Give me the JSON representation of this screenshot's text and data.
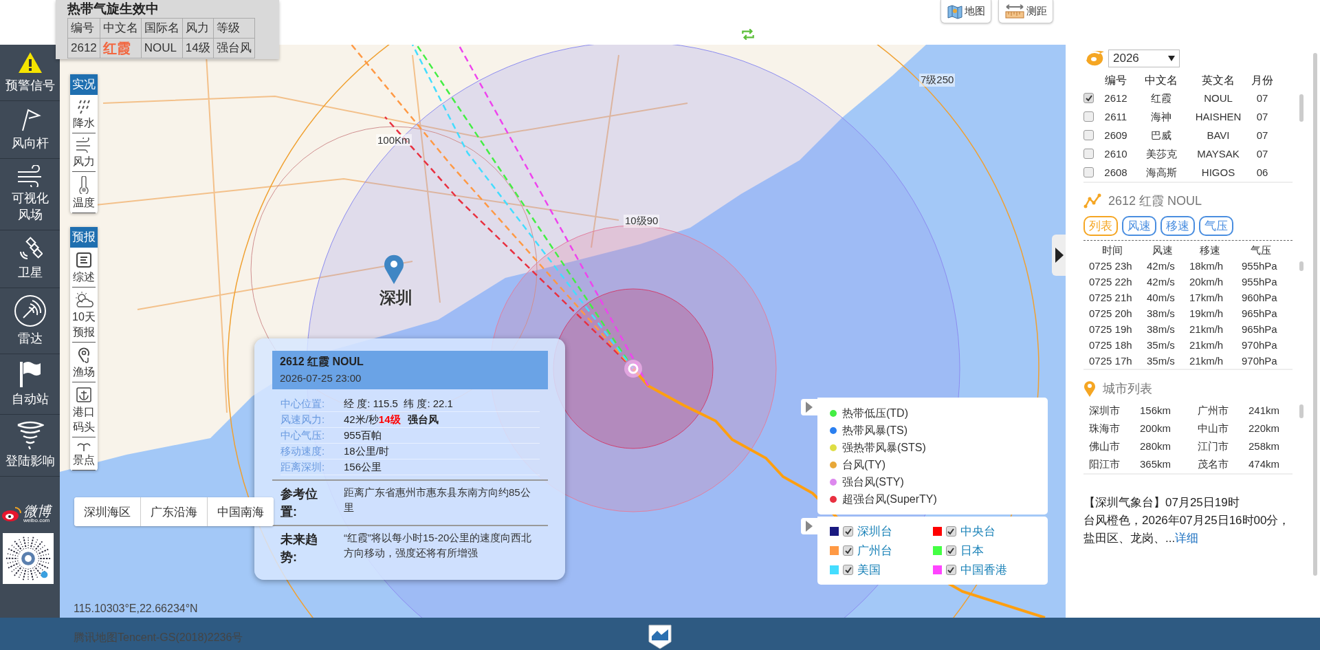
{
  "info_box": {
    "title": "热带气旋生效中",
    "columns": [
      "编号",
      "中文名",
      "国际名",
      "风力",
      "等级"
    ],
    "row": [
      "2612",
      "红霞",
      "NOUL",
      "14级",
      "强台风"
    ]
  },
  "toolbar": [
    {
      "kind": "map",
      "label": "地图"
    },
    {
      "kind": "ruler",
      "label": "测距"
    }
  ],
  "sidebar": [
    {
      "kind": "warning",
      "lines": [
        "预警信号"
      ]
    },
    {
      "kind": "vane",
      "lines": [
        "风向杆"
      ]
    },
    {
      "kind": "wind",
      "lines": [
        "可视化",
        "风场"
      ]
    },
    {
      "kind": "satellite",
      "lines": [
        "卫星"
      ]
    },
    {
      "kind": "radar",
      "lines": [
        "雷达"
      ]
    },
    {
      "kind": "flag",
      "lines": [
        "自动站"
      ]
    },
    {
      "kind": "tornado",
      "lines": [
        "登陆影响"
      ]
    }
  ],
  "weibo": {
    "name": "微博",
    "site": "weibo.com"
  },
  "layers": [
    {
      "title": "实况",
      "items": [
        {
          "kind": "rain",
          "lines": [
            "降水"
          ]
        },
        {
          "kind": "wind",
          "lines": [
            "风力"
          ]
        },
        {
          "kind": "temp",
          "lines": [
            "温度"
          ]
        }
      ]
    },
    {
      "title": "预报",
      "items": [
        {
          "kind": "summary",
          "lines": [
            "综述"
          ]
        },
        {
          "kind": "suncloud",
          "lines": [
            "10天",
            "预报"
          ]
        },
        {
          "kind": "fishing",
          "lines": [
            "渔场"
          ]
        },
        {
          "kind": "anchor",
          "lines": [
            "港口",
            "码头"
          ]
        },
        {
          "kind": "scenic",
          "lines": [
            "景点"
          ]
        }
      ]
    }
  ],
  "region_tabs": [
    "深圳海区",
    "广东沿海",
    "中国南海"
  ],
  "map": {
    "pin_label": "深圳",
    "circle_labels": [
      "100Km",
      "10级90",
      "7级250"
    ]
  },
  "popup": {
    "title": "2612 红霞 NOUL",
    "time": "2026-07-25 23:00",
    "details": [
      {
        "kind": "text",
        "label": "中心位置:",
        "value": "经 度: 115.5  纬 度: 22.1"
      },
      {
        "kind": "wind",
        "label": "风速风力:",
        "speed": "42米/秒",
        "force": "14级",
        "category": "强台风"
      },
      {
        "kind": "text",
        "label": "中心气压:",
        "value": "955百帕"
      },
      {
        "kind": "text",
        "label": "移动速度:",
        "value": "18公里/时"
      },
      {
        "kind": "text",
        "label": "距离深圳:",
        "value": "156公里"
      }
    ],
    "notes": [
      {
        "label": "参考位置:",
        "text": "距离广东省惠州市惠东县东南方向约85公里"
      },
      {
        "label": "未来趋势:",
        "text": "“红霞”将以每小时15-20公里的速度向西北方向移动，强度还将有所增强"
      }
    ]
  },
  "levels": [
    {
      "label": "热带低压(TD)",
      "color": "#44ee44"
    },
    {
      "label": "热带风暴(TS)",
      "color": "#2a7ff0"
    },
    {
      "label": "强热带风暴(STS)",
      "color": "#dede44"
    },
    {
      "label": "台风(TY)",
      "color": "#e8a838"
    },
    {
      "label": "强台风(STY)",
      "color": "#dd88ee"
    },
    {
      "label": "超强台风(SuperTY)",
      "color": "#e83040"
    }
  ],
  "agencies": [
    {
      "label": "深圳台",
      "color": "#1a1a80",
      "checked": true
    },
    {
      "label": "中央台",
      "color": "#ff0000",
      "checked": true
    },
    {
      "label": "广州台",
      "color": "#ff9944",
      "checked": true
    },
    {
      "label": "日本",
      "color": "#44ff44",
      "checked": true
    },
    {
      "label": "美国",
      "color": "#44ddff",
      "checked": true
    },
    {
      "label": "中国香港",
      "color": "#ff44ff",
      "checked": true
    }
  ],
  "coords": "115.10303°E,22.66234°N",
  "copyright": "腾讯地图Tencent-GS(2018)2236号",
  "panel": {
    "year": "2026",
    "typhoon_columns": [
      "编号",
      "中文名",
      "英文名",
      "月份"
    ],
    "typhoons": [
      {
        "id": "2612",
        "cn": "红霞",
        "en": "NOUL",
        "month": "07",
        "checked": true
      },
      {
        "id": "2611",
        "cn": "海神",
        "en": "HAISHEN",
        "month": "07",
        "checked": false
      },
      {
        "id": "2609",
        "cn": "巴威",
        "en": "BAVI",
        "month": "07",
        "checked": false
      },
      {
        "id": "2610",
        "cn": "美莎克",
        "en": "MAYSAK",
        "month": "07",
        "checked": false
      },
      {
        "id": "2608",
        "cn": "海高斯",
        "en": "HIGOS",
        "month": "06",
        "checked": false
      }
    ],
    "track_title": "2612 红霞 NOUL",
    "track_tabs": [
      {
        "label": "列表",
        "selected": true
      },
      {
        "label": "风速",
        "selected": false
      },
      {
        "label": "移速",
        "selected": false
      },
      {
        "label": "气压",
        "selected": false
      }
    ],
    "track_columns": [
      "时间",
      "风速",
      "移速",
      "气压"
    ],
    "track_rows": [
      [
        "0725 23h",
        "42m/s",
        "18km/h",
        "955hPa"
      ],
      [
        "0725 22h",
        "42m/s",
        "20km/h",
        "955hPa"
      ],
      [
        "0725 21h",
        "40m/s",
        "17km/h",
        "960hPa"
      ],
      [
        "0725 20h",
        "38m/s",
        "19km/h",
        "965hPa"
      ],
      [
        "0725 19h",
        "38m/s",
        "21km/h",
        "965hPa"
      ],
      [
        "0725 18h",
        "35m/s",
        "21km/h",
        "970hPa"
      ],
      [
        "0725 17h",
        "35m/s",
        "21km/h",
        "970hPa"
      ]
    ],
    "city_title": "城市列表",
    "cities": [
      {
        "name": "深圳市",
        "distance": "156km"
      },
      {
        "name": "广州市",
        "distance": "241km"
      },
      {
        "name": "珠海市",
        "distance": "200km"
      },
      {
        "name": "中山市",
        "distance": "220km"
      },
      {
        "name": "佛山市",
        "distance": "280km"
      },
      {
        "name": "江门市",
        "distance": "258km"
      },
      {
        "name": "阳江市",
        "distance": "365km"
      },
      {
        "name": "茂名市",
        "distance": "474km"
      }
    ],
    "notice": {
      "heading": "【深圳气象台】07月25日19时",
      "body": "台风橙色，2026年07月25日16时00分，盐田区、龙岗、...",
      "link": "详细"
    }
  }
}
